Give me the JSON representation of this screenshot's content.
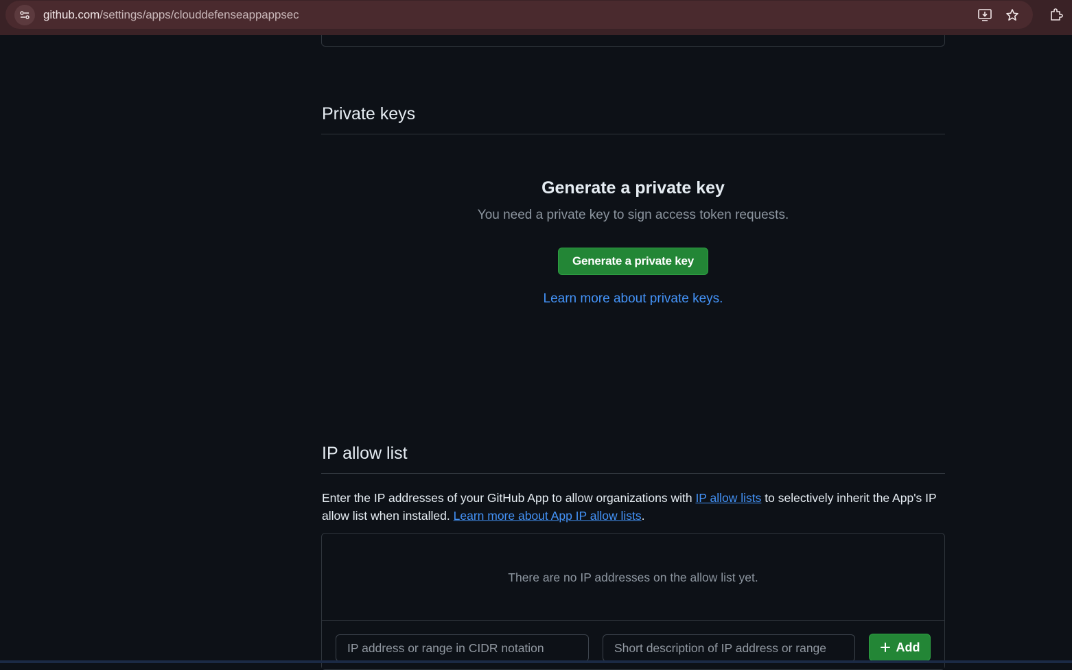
{
  "browser": {
    "url_host": "github.com",
    "url_path": "/settings/apps/clouddefenseappappsec",
    "icons": [
      "site-info-icon",
      "install-app-icon",
      "bookmark-star-icon",
      "extensions-icon"
    ]
  },
  "private_keys": {
    "section_title": "Private keys",
    "blankslate_title": "Generate a private key",
    "blankslate_description": "You need a private key to sign access token requests.",
    "generate_button_label": "Generate a private key",
    "learn_more_link": "Learn more about private keys",
    "learn_more_suffix": "."
  },
  "ip_allow_list": {
    "section_title": "IP allow list",
    "description_part1": "Enter the IP addresses of your GitHub App to allow organizations with ",
    "link_ip_allow_lists": "IP allow lists",
    "description_part2": " to selectively inherit the App's IP allow list when installed. ",
    "link_learn_more": "Learn more about App IP allow lists",
    "description_end": ".",
    "empty_message": "There are no IP addresses on the allow list yet.",
    "ip_input_placeholder": "IP address or range in CIDR notation",
    "description_input_placeholder": "Short description of IP address or range",
    "add_button_label": "Add",
    "add_button_icon": "plus-icon"
  },
  "colors": {
    "page_bg": "#0d1117",
    "browser_bar_bg": "#3a2226",
    "primary_button": "#238636",
    "link": "#4493f8",
    "muted_text": "#8d96a0",
    "border": "#30363d"
  }
}
